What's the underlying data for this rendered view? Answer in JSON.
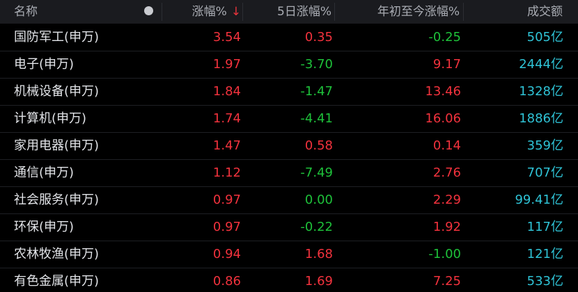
{
  "header": {
    "name": "名称",
    "change": "涨幅%",
    "sort_arrow": "↓",
    "change5d": "5日涨幅%",
    "ytd": "年初至今涨幅%",
    "turnover": "成交额",
    "indicator_icon": "dot-icon"
  },
  "colors": {
    "up": "#f2323d",
    "down": "#1ec13a",
    "turnover": "#2fc3d6",
    "header_bg": "#1a1b1f"
  },
  "rows": [
    {
      "name": "国防军工(申万)",
      "change": "3.54",
      "change5d": "0.35",
      "ytd": "-0.25",
      "turnover": "505亿"
    },
    {
      "name": "电子(申万)",
      "change": "1.97",
      "change5d": "-3.70",
      "ytd": "9.17",
      "turnover": "2444亿"
    },
    {
      "name": "机械设备(申万)",
      "change": "1.84",
      "change5d": "-1.47",
      "ytd": "13.46",
      "turnover": "1328亿"
    },
    {
      "name": "计算机(申万)",
      "change": "1.74",
      "change5d": "-4.41",
      "ytd": "16.06",
      "turnover": "1886亿"
    },
    {
      "name": "家用电器(申万)",
      "change": "1.47",
      "change5d": "0.58",
      "ytd": "0.14",
      "turnover": "359亿"
    },
    {
      "name": "通信(申万)",
      "change": "1.12",
      "change5d": "-7.49",
      "ytd": "2.76",
      "turnover": "707亿"
    },
    {
      "name": "社会服务(申万)",
      "change": "0.97",
      "change5d": "0.00",
      "ytd": "2.29",
      "turnover": "99.41亿"
    },
    {
      "name": "环保(申万)",
      "change": "0.97",
      "change5d": "-0.22",
      "ytd": "1.92",
      "turnover": "117亿"
    },
    {
      "name": "农林牧渔(申万)",
      "change": "0.94",
      "change5d": "1.68",
      "ytd": "-1.00",
      "turnover": "121亿"
    },
    {
      "name": "有色金属(申万)",
      "change": "0.86",
      "change5d": "1.69",
      "ytd": "7.25",
      "turnover": "533亿"
    }
  ]
}
